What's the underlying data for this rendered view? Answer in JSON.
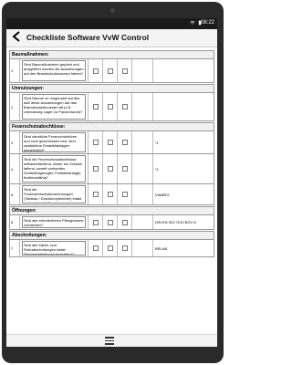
{
  "status": {
    "time": "08:22"
  },
  "appbar": {
    "title": "Checkliste Software VvW Control"
  },
  "sections": [
    {
      "title": "Baumaßnahmen:",
      "rows": [
        {
          "num": "1",
          "question": "Sind Baumaßnahmen geplant und ausgeführt worden die Auswirkungen auf den Brandschutzkonzept haben?",
          "ref": ""
        }
      ]
    },
    {
      "title": "Umnutzungen:",
      "rows": [
        {
          "num": "2",
          "question": "Sind Räume so umgenutzt worden, daß diese Auswirkungen auf das Brandschutzkonzept hat (z.B. Umnutzung Lager zu Pausenraum)?",
          "ref": ""
        }
      ]
    },
    {
      "title": "Feuerschutzabschlüsse:",
      "rows": [
        {
          "num": "3",
          "question": "Sind sämtliche Feuerschutztüren und rooe geschlossen bzw. sind zusätzliche Feststellanlagen eingerichtet?",
          "ref": "*1"
        },
        {
          "num": "4",
          "question": "Sind die Feuerschutzabschlüsse selbstschließend, sicher ins Schloss fallend, soweit vorhanden, Schließfolgeregler, Feststellanlage) funktionsfähig?",
          "ref": "*1"
        },
        {
          "num": "5",
          "question": "Sind die Feuerwehrschaltvorrichtungen (Tableau / Druckknopfmelder) intakt und zugänglich?",
          "ref": "VdsBRG"
        }
      ]
    },
    {
      "title": "Öffnungen:",
      "rows": [
        {
          "num": "6",
          "question": "Sind alle erforderlichen Piktogramme vorhanden?",
          "ref": "DIN EN ISO 7010 BGV D"
        }
      ]
    },
    {
      "title": "Abschottungen:",
      "rows": [
        {
          "num": "7",
          "question": "Sind alle Kabel- und Rohrabschottungen intakt (Nachinstallationen beachten)?",
          "ref": "BRLAB"
        }
      ]
    }
  ],
  "icons": {
    "back": "arrow-back-icon",
    "menu": "menu-icon",
    "wifi": "wifi-icon",
    "battery": "battery-icon"
  }
}
